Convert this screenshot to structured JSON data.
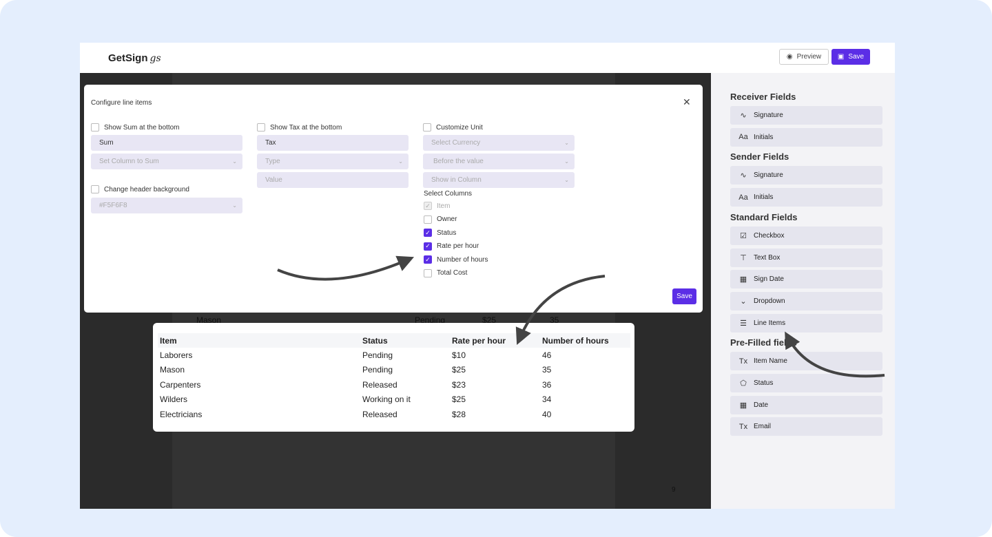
{
  "header": {
    "logo": "GetSign",
    "logo_mark": "gs",
    "preview_label": "Preview",
    "save_label": "Save"
  },
  "canvas": {
    "page_number": "9",
    "behind_row": [
      "Mason",
      "Pending",
      "$25",
      "35"
    ]
  },
  "panel": {
    "sections": [
      {
        "title": "Receiver Fields",
        "items": [
          {
            "icon": "signature-icon",
            "label": "Signature"
          },
          {
            "icon": "initials-icon",
            "label": "Initials"
          }
        ]
      },
      {
        "title": "Sender Fields",
        "items": [
          {
            "icon": "signature-icon",
            "label": "Signature"
          },
          {
            "icon": "initials-icon",
            "label": "Initials"
          }
        ]
      },
      {
        "title": "Standard Fields",
        "items": [
          {
            "icon": "checkbox-icon",
            "label": "Checkbox"
          },
          {
            "icon": "textbox-icon",
            "label": "Text Box"
          },
          {
            "icon": "calendar-icon",
            "label": "Sign Date"
          },
          {
            "icon": "dropdown-icon",
            "label": "Dropdown"
          },
          {
            "icon": "list-icon",
            "label": "Line Items"
          }
        ]
      },
      {
        "title": "Pre-Filled fields",
        "items": [
          {
            "icon": "text-format-icon",
            "label": "Item Name"
          },
          {
            "icon": "tag-icon",
            "label": "Status"
          },
          {
            "icon": "calendar-icon",
            "label": "Date"
          },
          {
            "icon": "text-format-icon",
            "label": "Email"
          }
        ]
      }
    ]
  },
  "modal": {
    "title": "Configure line items",
    "show_sum": {
      "label": "Show Sum at the bottom",
      "checked": false,
      "value": "Sum",
      "column_placeholder": "Set Column to Sum"
    },
    "header_bg": {
      "label": "Change header background",
      "checked": false,
      "value": "#F5F6F8"
    },
    "show_tax": {
      "label": "Show Tax at the bottom",
      "checked": false,
      "value": "Tax",
      "type_placeholder": "Type",
      "value_placeholder": "Value"
    },
    "unit": {
      "label": "Customize Unit",
      "checked": false,
      "currency_placeholder": "Select Currency",
      "position_placeholder": "Before the value",
      "column_placeholder": "Show in Column"
    },
    "select_columns_label": "Select Columns",
    "columns": [
      {
        "label": "Item",
        "checked": true,
        "disabled": true
      },
      {
        "label": "Owner",
        "checked": false
      },
      {
        "label": "Status",
        "checked": true
      },
      {
        "label": "Rate per hour",
        "checked": true
      },
      {
        "label": "Number of hours",
        "checked": true
      },
      {
        "label": "Total Cost",
        "checked": false
      }
    ],
    "save_label": "Save"
  },
  "table": {
    "headers": [
      "Item",
      "Status",
      "Rate per hour",
      "Number of hours"
    ],
    "rows": [
      [
        "Laborers",
        "Pending",
        "$10",
        "46"
      ],
      [
        "Mason",
        "Pending",
        "$25",
        "35"
      ],
      [
        "Carpenters",
        "Released",
        "$23",
        "36"
      ],
      [
        "Wilders",
        "Working on it",
        "$25",
        "34"
      ],
      [
        "Electricians",
        "Released",
        "$28",
        "40"
      ]
    ],
    "header_bg": "#F5F6F8"
  },
  "colors": {
    "accent": "#5B2EE6",
    "background": "#E4EEFD"
  }
}
